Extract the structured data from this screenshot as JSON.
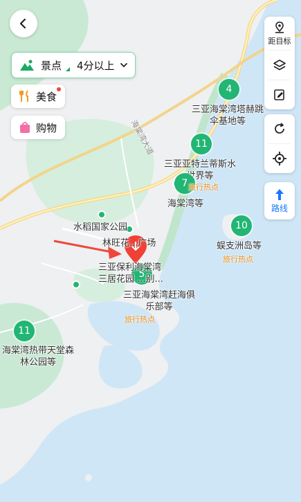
{
  "back": {
    "icon": "chevron-left-icon"
  },
  "filter": {
    "category": "景点",
    "rating": "4分以上",
    "icon": "mountain-icon"
  },
  "chips": [
    {
      "label": "美食",
      "icon": "fork-knife-icon"
    },
    {
      "label": "购物",
      "icon": "shopping-bag-icon"
    }
  ],
  "right_panel": {
    "distance_label": "距目标",
    "layers_icon": "layers-icon",
    "notes_icon": "edit-note-icon",
    "refresh_icon": "refresh-icon",
    "locate_icon": "locate-icon",
    "route_label": "路线"
  },
  "road_name": "海棠湾大道",
  "clusters": [
    {
      "count": "4",
      "label": "三亚海棠湾塔赫跳\n伞基地等"
    },
    {
      "count": "11",
      "label": "三亚亚特兰蒂斯水\n世界等"
    },
    {
      "count": "7",
      "label": "海棠湾等",
      "hot": "旅行热点"
    },
    {
      "count": "10",
      "label": "蜈支洲岛等",
      "hot": "旅行热点"
    },
    {
      "count": "5",
      "label": "三亚保利海棠湾\n三居花园 ...别..."
    },
    {
      "count": "11",
      "label": "海棠湾热带天堂森\n林公园等"
    }
  ],
  "places": [
    {
      "label": "水稻国家公园"
    },
    {
      "label": "林旺花...广场"
    },
    {
      "label": "三亚海棠湾赶海俱\n乐部等",
      "hot": "旅行热点"
    }
  ],
  "colors": {
    "sea": "#cfe6f7",
    "land": "#eef0f1",
    "forest": "#c9e9d4",
    "cluster": "#22b573",
    "accent": "#1677ff",
    "hot": "#e98d13"
  }
}
